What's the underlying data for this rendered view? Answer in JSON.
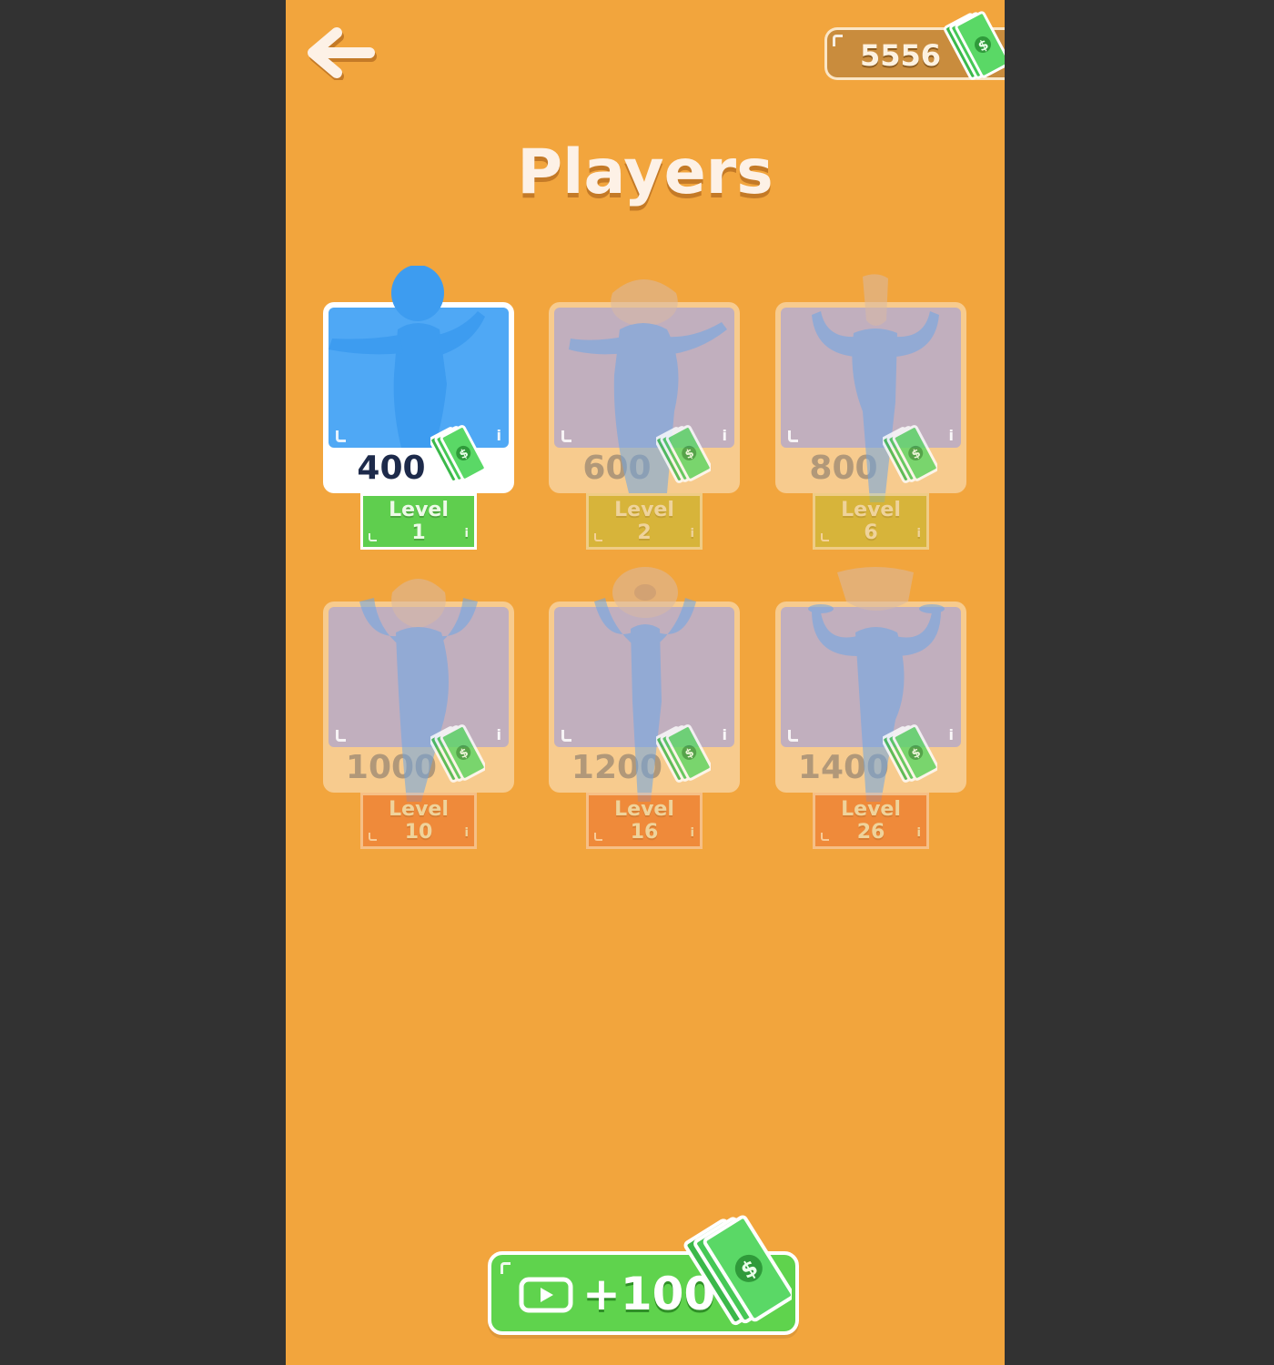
{
  "header": {
    "back_icon": "back-arrow-icon",
    "balance": "5556"
  },
  "title": "Players",
  "players": [
    {
      "price": "400",
      "level_label": "Level",
      "level_num": "1",
      "state": "selected",
      "level_color": "green"
    },
    {
      "price": "600",
      "level_label": "Level",
      "level_num": "2",
      "state": "locked",
      "level_color": "yellow"
    },
    {
      "price": "800",
      "level_label": "Level",
      "level_num": "6",
      "state": "locked",
      "level_color": "yellow"
    },
    {
      "price": "1000",
      "level_label": "Level",
      "level_num": "10",
      "state": "locked",
      "level_color": "orange"
    },
    {
      "price": "1200",
      "level_label": "Level",
      "level_num": "16",
      "state": "locked",
      "level_color": "orange"
    },
    {
      "price": "1400",
      "level_label": "Level",
      "level_num": "26",
      "state": "locked",
      "level_color": "orange"
    }
  ],
  "ad_button": {
    "reward": "+100",
    "icon": "video-play-icon"
  },
  "card_info_glyph": "i",
  "colors": {
    "background": "#f2a53d",
    "side_bars": "#323232",
    "card_selected": "#4fa8f5",
    "level_green": "#5fce4e",
    "level_yellow": "#c2c238",
    "level_orange": "#ee7438",
    "ad_button": "#5fd34d"
  }
}
